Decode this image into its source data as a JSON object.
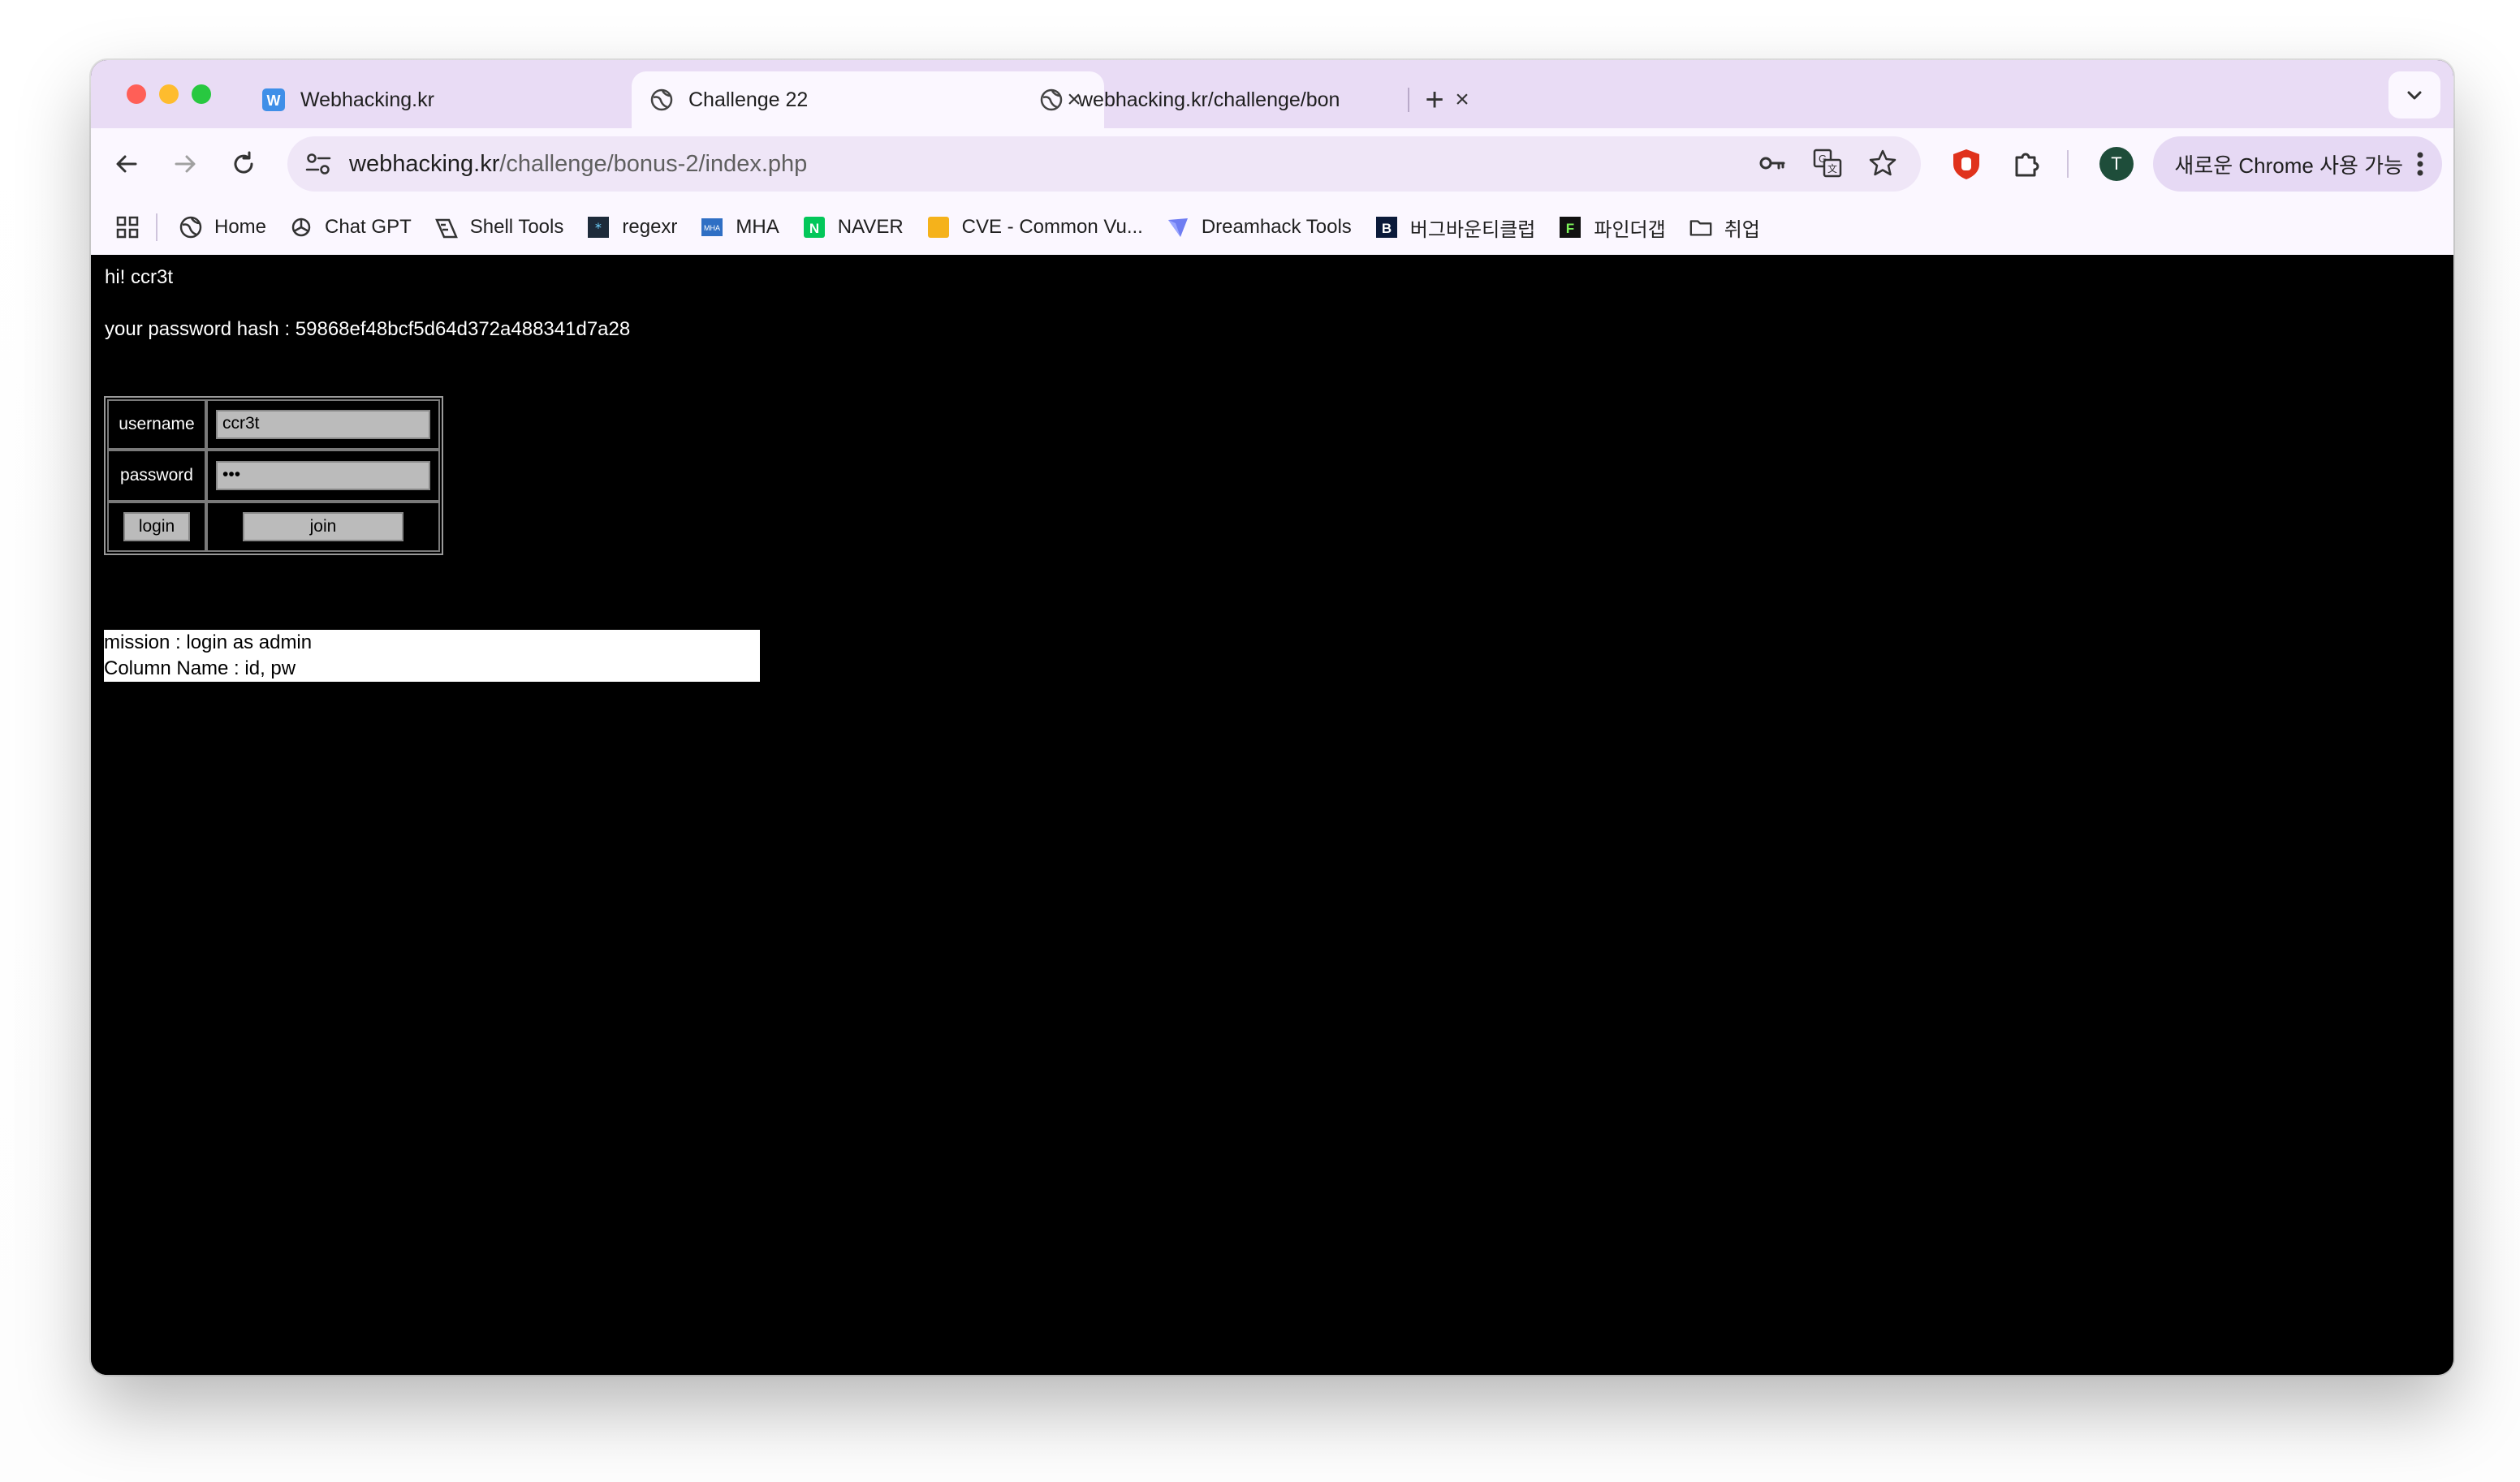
{
  "browser": {
    "tabs": [
      {
        "title": "Webhacking.kr",
        "favicon": "w-logo-icon"
      },
      {
        "title": "Challenge 22",
        "favicon": "globe-icon"
      },
      {
        "title": "webhacking.kr/challenge/bon",
        "favicon": "globe-icon"
      }
    ],
    "url_host": "webhacking.kr",
    "url_path": "/challenge/bonus-2/index.php",
    "profile_initial": "T",
    "chrome_pill": "새로운 Chrome 사용 가능",
    "bookmarks": [
      {
        "label": "Home",
        "icon": "globe-icon"
      },
      {
        "label": "Chat GPT",
        "icon": "openai-icon"
      },
      {
        "label": "Shell Tools",
        "icon": "shell-icon"
      },
      {
        "label": "regexr",
        "icon": "regexr-icon"
      },
      {
        "label": "MHA",
        "icon": "mha-icon"
      },
      {
        "label": "NAVER",
        "icon": "naver-icon"
      },
      {
        "label": "CVE - Common Vu...",
        "icon": "cve-icon"
      },
      {
        "label": "Dreamhack Tools",
        "icon": "dreamhack-icon"
      },
      {
        "label": "버그바운티클럽",
        "icon": "bugbounty-icon"
      },
      {
        "label": "파인더갭",
        "icon": "findergap-icon"
      },
      {
        "label": "취업",
        "icon": "folder-icon"
      }
    ]
  },
  "page": {
    "greeting": "hi! ccr3t",
    "hash_text": "your password hash : 59868ef48bcf5d64d372a488341d7a28",
    "form": {
      "username_label": "username",
      "username_value": "ccr3t",
      "password_label": "password",
      "password_value": "•••",
      "login_label": "login",
      "join_label": "join"
    },
    "mission_line1": "mission : login as admin",
    "mission_line2": "Column Name : id, pw"
  }
}
